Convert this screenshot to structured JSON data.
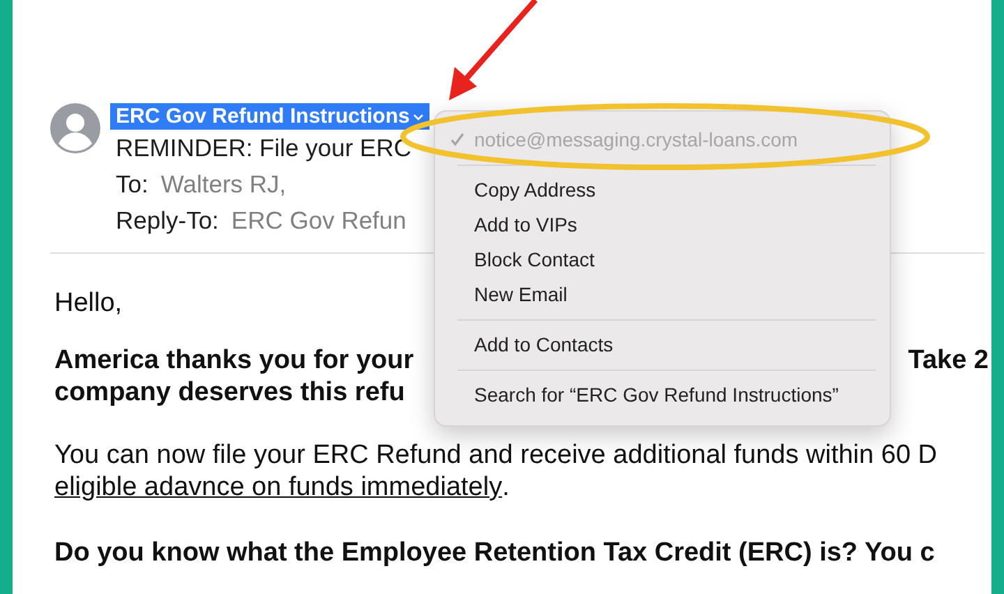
{
  "message": {
    "sender": "ERC Gov Refund Instructions",
    "sender_selected": true,
    "subject": "REMINDER: File your ERC",
    "to_label": "To:",
    "to": "Walters RJ,",
    "reply_to_label": "Reply-To:",
    "reply_to": "ERC Gov Refun"
  },
  "body": [
    {
      "kind": "plain",
      "left": "Hello,"
    },
    {
      "kind": "bold",
      "left": "America thanks you for your",
      "right": "Take 2"
    },
    {
      "kind": "bold",
      "left": "company deserves this refu"
    },
    {
      "kind": "plain",
      "left": "You can now file your ERC Refund and receive additional funds within 60 D"
    },
    {
      "kind": "link",
      "left": "eligible adavnce on funds immediately",
      "after": "."
    },
    {
      "kind": "bold",
      "left": "Do you know what the Employee Retention Tax Credit (ERC) is? You c"
    }
  ],
  "menu": {
    "groups": [
      [
        {
          "label": "notice@messaging.crystal-loans.com",
          "checked": true,
          "disabled": true
        }
      ],
      [
        {
          "label": "Copy Address",
          "checked": false,
          "disabled": false
        },
        {
          "label": "Add to VIPs",
          "checked": false,
          "disabled": false
        },
        {
          "label": "Block Contact",
          "checked": false,
          "disabled": false
        },
        {
          "label": "New Email",
          "checked": false,
          "disabled": false
        }
      ],
      [
        {
          "label": "Add to Contacts",
          "checked": false,
          "disabled": false
        }
      ],
      [
        {
          "label": "Search for “ERC Gov Refund Instructions”",
          "checked": false,
          "disabled": false
        }
      ]
    ]
  },
  "annotations": [
    {
      "kind": "arrow",
      "color": "#e8231d"
    },
    {
      "kind": "ellipse",
      "color": "#f2c12e"
    }
  ]
}
